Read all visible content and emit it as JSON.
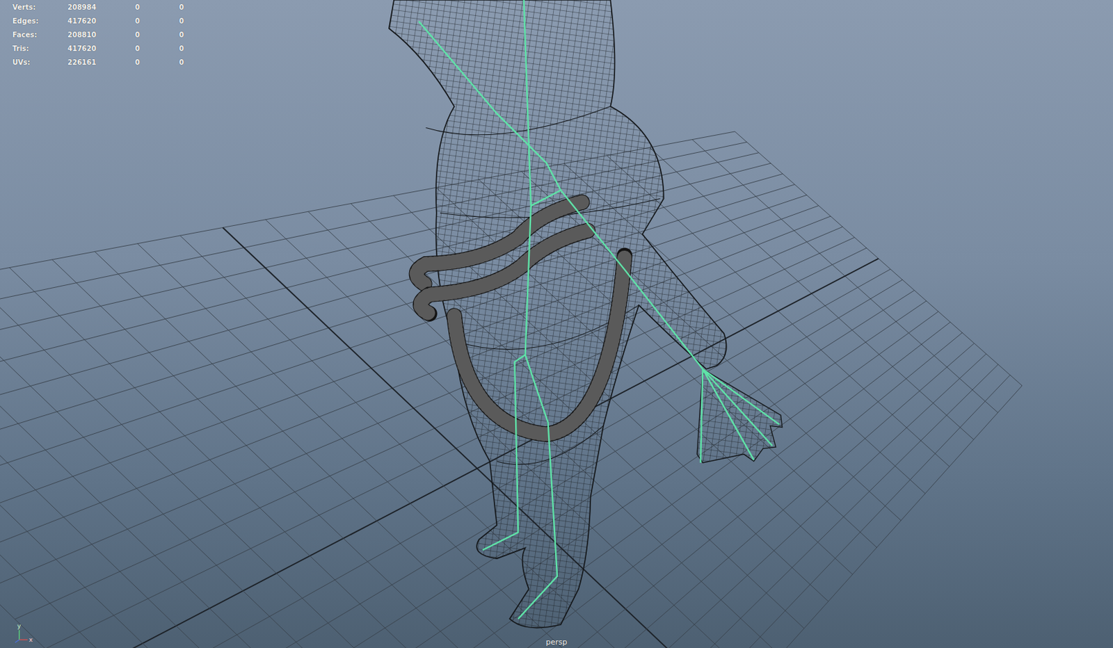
{
  "hud": [
    {
      "label": "Verts:",
      "values": [
        "208984",
        "0",
        "0"
      ]
    },
    {
      "label": "Edges:",
      "values": [
        "417620",
        "0",
        "0"
      ]
    },
    {
      "label": "Faces:",
      "values": [
        "208810",
        "0",
        "0"
      ]
    },
    {
      "label": "Tris:",
      "values": [
        "417620",
        "0",
        "0"
      ]
    },
    {
      "label": "UVs:",
      "values": [
        "226161",
        "0",
        "0"
      ]
    }
  ],
  "camera_label": "persp",
  "axis": {
    "labels": [
      "y",
      "x"
    ]
  }
}
